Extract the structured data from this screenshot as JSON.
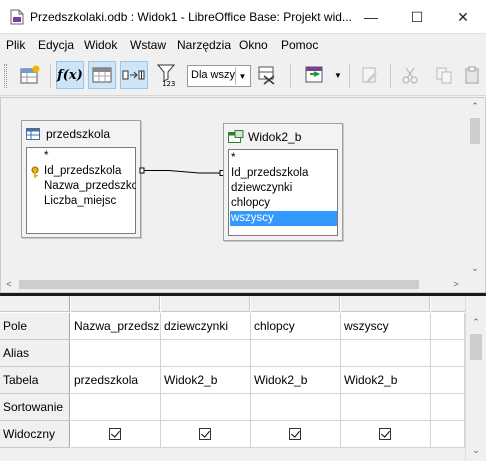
{
  "window": {
    "title": "Przedszkolaki.odb : Widok1 - LibreOffice Base: Projekt wid...",
    "minimize": "—",
    "maximize": "☐",
    "close": "✕"
  },
  "menu": [
    "Plik",
    "Edycja",
    "Widok",
    "Wstaw",
    "Narzędzia",
    "Okno",
    "Pomoc"
  ],
  "toolbar": {
    "filter_value": "Dla wszy",
    "filter_arrow": "▼"
  },
  "tables": [
    {
      "title": "przedszkola",
      "fields": [
        "*",
        "Id_przedszkola",
        "Nazwa_przedszko",
        "Liczba_miejsc"
      ]
    },
    {
      "title": "Widok2_b",
      "fields": [
        "*",
        "Id_przedszkola",
        "dziewczynki",
        "chlopcy",
        "wszyscy"
      ],
      "selected": "wszyscy"
    }
  ],
  "grid": {
    "row_labels": [
      "Pole",
      "Alias",
      "Tabela",
      "Sortowanie",
      "Widoczny"
    ],
    "columns": [
      {
        "pole": "Nazwa_przedszk",
        "alias": "",
        "tabela": "przedszkola",
        "sort": "",
        "visible": true
      },
      {
        "pole": "dziewczynki",
        "alias": "",
        "tabela": "Widok2_b",
        "sort": "",
        "visible": true
      },
      {
        "pole": "chlopcy",
        "alias": "",
        "tabela": "Widok2_b",
        "sort": "",
        "visible": true
      },
      {
        "pole": "wszyscy",
        "alias": "",
        "tabela": "Widok2_b",
        "sort": "",
        "visible": true
      },
      {
        "pole": "",
        "alias": "",
        "tabela": "",
        "sort": "",
        "visible": false
      }
    ]
  },
  "colors": {
    "selection": "#3399ff",
    "active_tool": "#cde5f7"
  }
}
